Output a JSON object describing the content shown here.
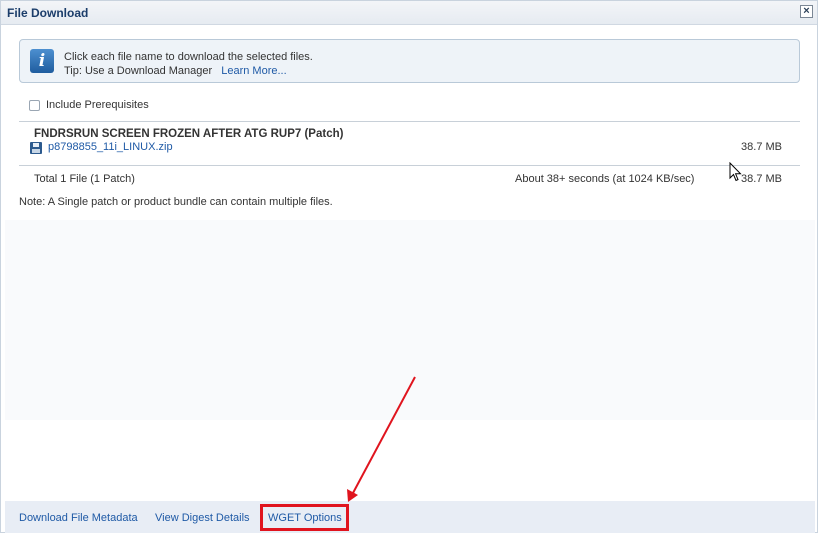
{
  "dialog": {
    "title": "File Download",
    "close_glyph": "×"
  },
  "info": {
    "icon": "info-icon",
    "line1": "Click each file name to download the selected files.",
    "tip_prefix": "Tip: Use a Download Manager",
    "tip_link": "Learn More..."
  },
  "prerequisites": {
    "label": "Include Prerequisites",
    "checked": false
  },
  "patch": {
    "title": "FNDRSRUN SCREEN FROZEN AFTER ATG RUP7 (Patch)",
    "file_icon": "floppy-disk-icon",
    "file_name": "p8798855_11i_LINUX.zip",
    "file_size": "38.7 MB"
  },
  "total": {
    "label": "Total 1 File (1 Patch)",
    "time": "About 38+ seconds (at 1024 KB/sec)",
    "size": "38.7 MB"
  },
  "note": "Note: A Single patch or product bundle can contain multiple files.",
  "footer": {
    "metadata_link": "Download File Metadata",
    "digest_link": "View Digest Details",
    "wget_link": "WGET Options"
  },
  "colors": {
    "link": "#1f5aa6",
    "title": "#1b3d6a",
    "annotation_red": "#e0141e"
  }
}
